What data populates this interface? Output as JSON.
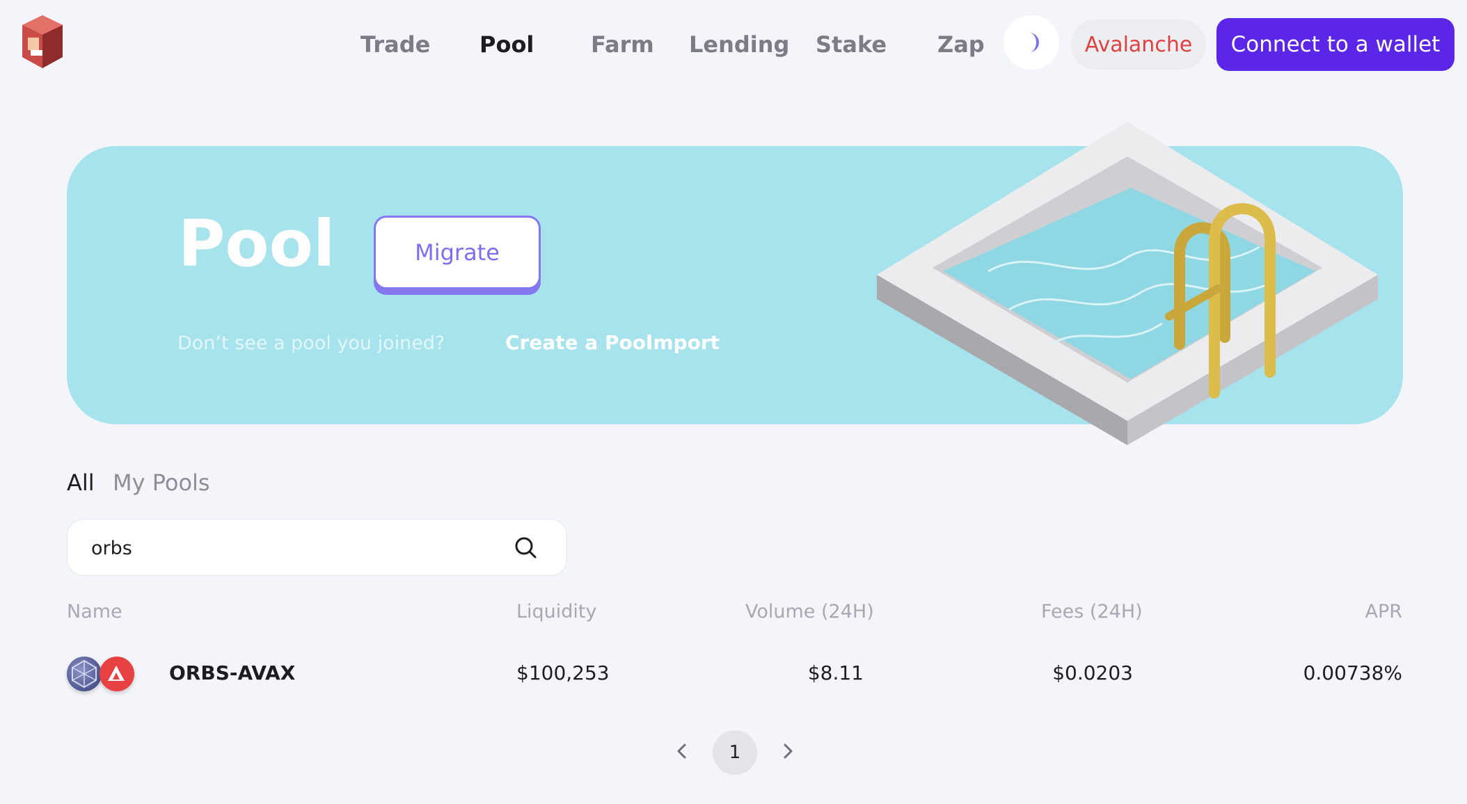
{
  "nav": {
    "items": [
      {
        "label": "Trade",
        "active": false
      },
      {
        "label": "Pool",
        "active": true
      },
      {
        "label": "Farm",
        "active": false
      },
      {
        "label": "Lending",
        "active": false
      },
      {
        "label": "Stake",
        "active": false
      },
      {
        "label": "Zap",
        "active": false
      }
    ],
    "theme_icon": "moon-icon",
    "network_label": "Avalanche",
    "connect_label": "Connect to a wallet"
  },
  "hero": {
    "title": "Pool",
    "migrate_label": "Migrate",
    "question": "Don’t see a pool you joined?",
    "create_label": "Create a Pool",
    "import_label": "Import"
  },
  "tabs": [
    {
      "label": "All",
      "active": true
    },
    {
      "label": "My Pools",
      "active": false
    }
  ],
  "search": {
    "value": "orbs",
    "icon": "search-icon"
  },
  "table": {
    "columns": [
      "Name",
      "Liquidity",
      "Volume (24H)",
      "Fees (24H)",
      "APR"
    ],
    "rows": [
      {
        "name": "ORBS-AVAX",
        "liquidity": "$100,253",
        "volume": "$8.11",
        "fees": "$0.0203",
        "apr": "0.00738%",
        "icons": [
          "orbs-token-icon",
          "avax-token-icon"
        ]
      }
    ]
  },
  "pagination": {
    "current": "1"
  },
  "colors": {
    "accent": "#5b26e8",
    "hero_bg": "#a6e3ec",
    "network": "#e0413e",
    "migrate": "#7b6ef0"
  }
}
